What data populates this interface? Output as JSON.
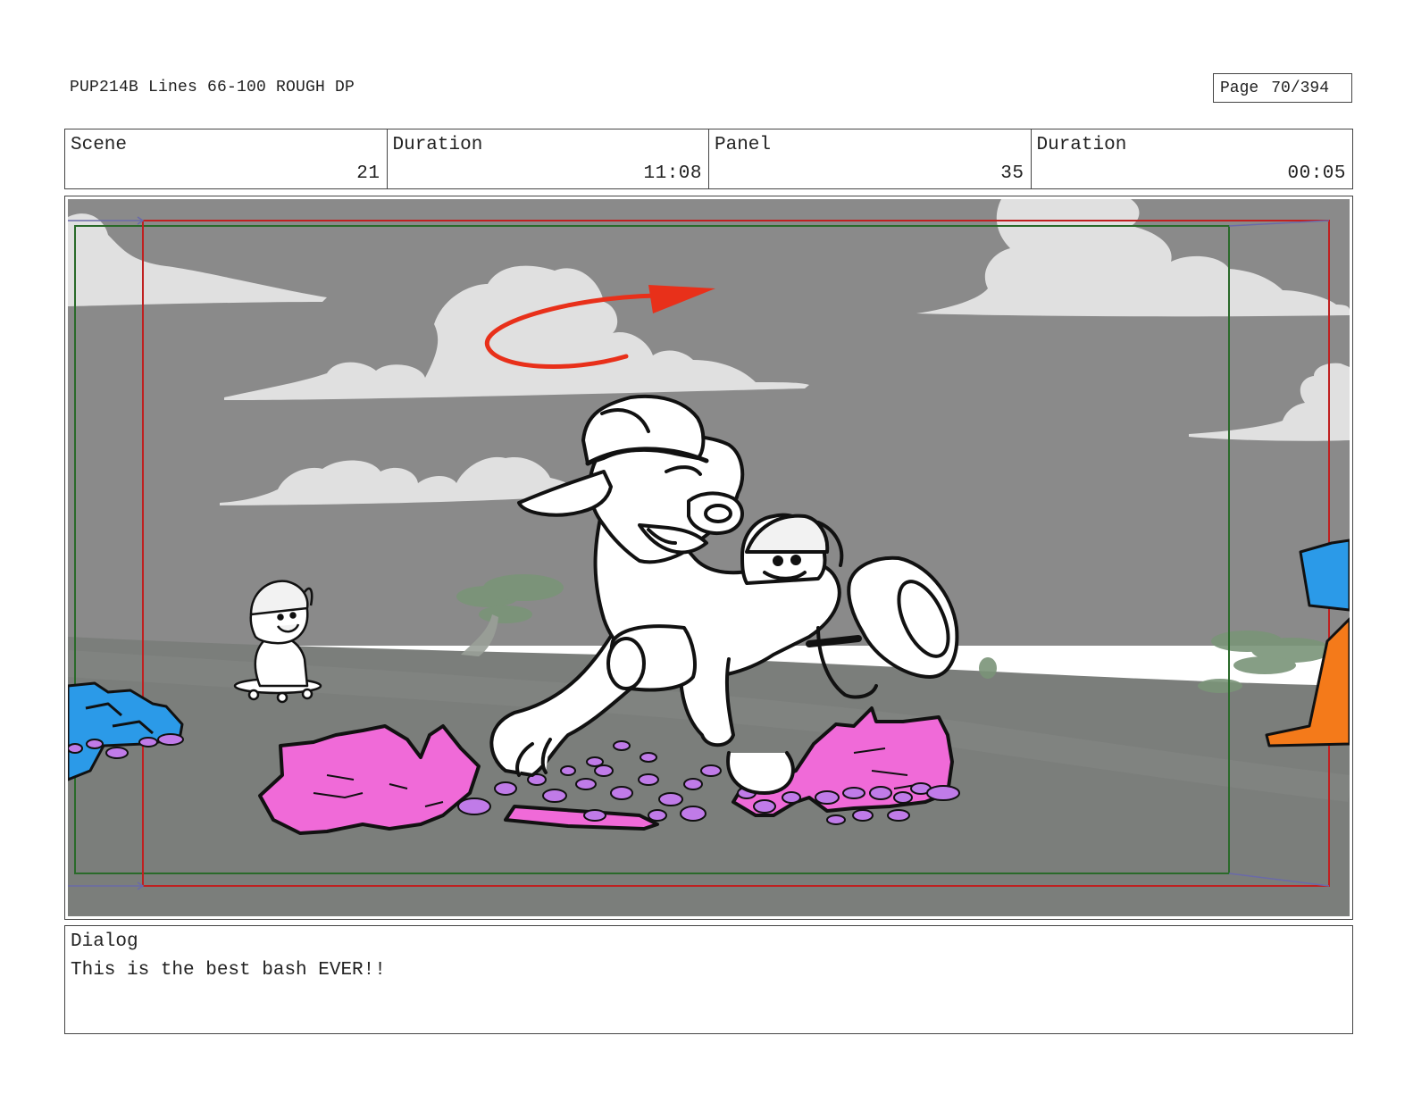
{
  "header": {
    "title": "PUP214B Lines 66-100 ROUGH DP",
    "page_label": "Page",
    "page_number": "70/394"
  },
  "info": {
    "scene_label": "Scene",
    "scene_value": "21",
    "scene_duration_label": "Duration",
    "scene_duration_value": "11:08",
    "panel_label": "Panel",
    "panel_value": "35",
    "panel_duration_label": "Duration",
    "panel_duration_value": "00:05"
  },
  "dialog": {
    "label": "Dialog",
    "text": "This is the best bash EVER!!"
  },
  "colors": {
    "sky": "#8a8a8a",
    "ground": "#7b7e7b",
    "cloud": "#e0e0e0",
    "rock_pink": "#f06ad8",
    "pebble_purple": "#c07be8",
    "rock_blue": "#2b9ae8",
    "cone_orange": "#f47a1a",
    "arrow_red": "#e8301a",
    "safe_frame_green": "#2a6a2a",
    "camera_frame_red": "#c02020"
  }
}
